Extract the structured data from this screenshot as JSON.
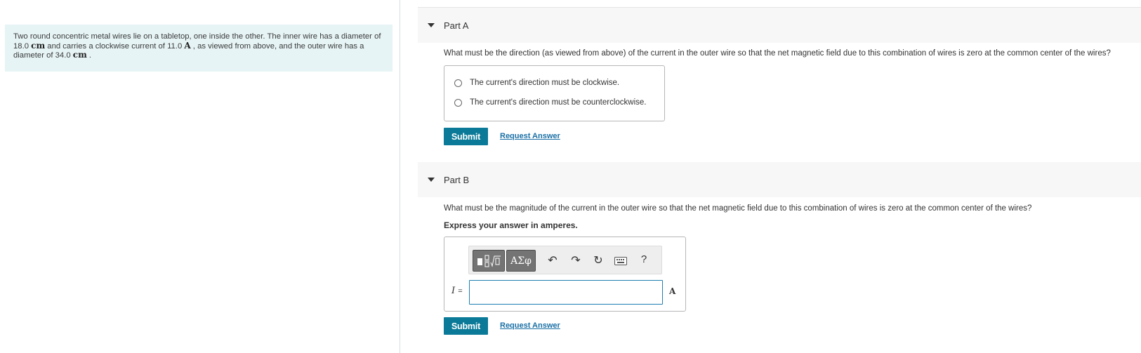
{
  "problem": {
    "text_1": "Two round concentric metal wires lie on a tabletop, one inside the other. The inner wire has a diameter of 18.0 ",
    "unit_cm_1": "cm",
    "text_2": " and carries a clockwise current of 11.0 ",
    "unit_A": "A",
    "text_3": " , as viewed from above, and the outer wire has a diameter of 34.0 ",
    "unit_cm_2": "cm",
    "text_4": " ."
  },
  "partA": {
    "title": "Part A",
    "question": "What must be the direction (as viewed from above) of the current in the outer wire so that the net magnetic field due to this combination of wires is zero at the common center of the wires?",
    "options": [
      "The current's direction must be clockwise.",
      "The current's direction must be counterclockwise."
    ],
    "submit_label": "Submit",
    "request_label": "Request Answer"
  },
  "partB": {
    "title": "Part B",
    "question": "What must be the magnitude of the current in the outer wire so that the net magnetic field due to this combination of wires is zero at the common center of the wires?",
    "instruction": "Express your answer in amperes.",
    "toolbar": {
      "template_icon": "fraction-sqrt-template-icon",
      "symbols_label": "ΑΣφ",
      "undo_icon": "undo-icon",
      "redo_icon": "redo-icon",
      "reset_icon": "reset-icon",
      "keyboard_icon": "keyboard-icon",
      "help_label": "?"
    },
    "variable_label": "I",
    "equals_label": "=",
    "input_value": "",
    "unit_label": "A",
    "submit_label": "Submit",
    "request_label": "Request Answer"
  },
  "colors": {
    "accent": "#0a7a98",
    "link": "#1a6fa5",
    "problem_bg": "#e7f4f5"
  }
}
